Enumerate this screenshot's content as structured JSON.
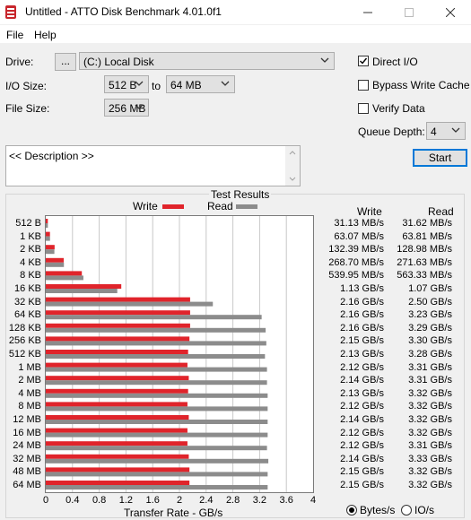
{
  "window": {
    "title": "Untitled - ATTO Disk Benchmark 4.01.0f1"
  },
  "menu": [
    "File",
    "Help"
  ],
  "controls": {
    "drive_label": "Drive:",
    "browse_label": "...",
    "drive_value": "(C:) Local Disk",
    "io_size_label": "I/O Size:",
    "io_from": "512 B",
    "io_to_label": "to",
    "io_to": "64 MB",
    "file_size_label": "File Size:",
    "file_size": "256 MB",
    "direct_io_label": "Direct I/O",
    "direct_io_checked": true,
    "bypass_label": "Bypass Write Cache",
    "bypass_checked": false,
    "verify_label": "Verify Data",
    "verify_checked": false,
    "queue_depth_label": "Queue Depth:",
    "queue_depth": "4",
    "start_label": "Start",
    "description": "<< Description >>"
  },
  "results": {
    "title": "Test Results",
    "write_header": "Write",
    "read_header": "Read",
    "units_bytes": "Bytes/s",
    "units_io": "IO/s",
    "units_selected": "bytes"
  },
  "chart_data": {
    "type": "bar",
    "orientation": "horizontal",
    "xlabel": "Transfer Rate - GB/s",
    "xlim": [
      0,
      4
    ],
    "xticks": [
      "0",
      "0.4",
      "0.8",
      "1.2",
      "1.6",
      "2",
      "2.4",
      "2.8",
      "3.2",
      "3.6",
      "4"
    ],
    "legend": [
      "Write",
      "Read"
    ],
    "colors": {
      "write": "#e0242b",
      "read": "#8c8c8c"
    },
    "categories": [
      "512 B",
      "1 KB",
      "2 KB",
      "4 KB",
      "8 KB",
      "16 KB",
      "32 KB",
      "64 KB",
      "128 KB",
      "256 KB",
      "512 KB",
      "1 MB",
      "2 MB",
      "4 MB",
      "8 MB",
      "12 MB",
      "16 MB",
      "24 MB",
      "32 MB",
      "48 MB",
      "64 MB"
    ],
    "series": [
      {
        "name": "Write",
        "values": [
          0.03113,
          0.06307,
          0.13239,
          0.2687,
          0.53995,
          1.13,
          2.16,
          2.16,
          2.16,
          2.15,
          2.13,
          2.12,
          2.14,
          2.13,
          2.12,
          2.14,
          2.12,
          2.12,
          2.14,
          2.15,
          2.15
        ],
        "labels": [
          "31.13 MB/s",
          "63.07 MB/s",
          "132.39 MB/s",
          "268.70 MB/s",
          "539.95 MB/s",
          "1.13 GB/s",
          "2.16 GB/s",
          "2.16 GB/s",
          "2.16 GB/s",
          "2.15 GB/s",
          "2.13 GB/s",
          "2.12 GB/s",
          "2.14 GB/s",
          "2.13 GB/s",
          "2.12 GB/s",
          "2.14 GB/s",
          "2.12 GB/s",
          "2.12 GB/s",
          "2.14 GB/s",
          "2.15 GB/s",
          "2.15 GB/s"
        ]
      },
      {
        "name": "Read",
        "values": [
          0.03162,
          0.06381,
          0.12898,
          0.27163,
          0.56333,
          1.07,
          2.5,
          3.23,
          3.29,
          3.3,
          3.28,
          3.31,
          3.31,
          3.32,
          3.32,
          3.32,
          3.32,
          3.31,
          3.33,
          3.32,
          3.32
        ],
        "labels": [
          "31.62 MB/s",
          "63.81 MB/s",
          "128.98 MB/s",
          "271.63 MB/s",
          "563.33 MB/s",
          "1.07 GB/s",
          "2.50 GB/s",
          "3.23 GB/s",
          "3.29 GB/s",
          "3.30 GB/s",
          "3.28 GB/s",
          "3.31 GB/s",
          "3.31 GB/s",
          "3.32 GB/s",
          "3.32 GB/s",
          "3.32 GB/s",
          "3.32 GB/s",
          "3.31 GB/s",
          "3.33 GB/s",
          "3.32 GB/s",
          "3.32 GB/s"
        ]
      }
    ]
  }
}
